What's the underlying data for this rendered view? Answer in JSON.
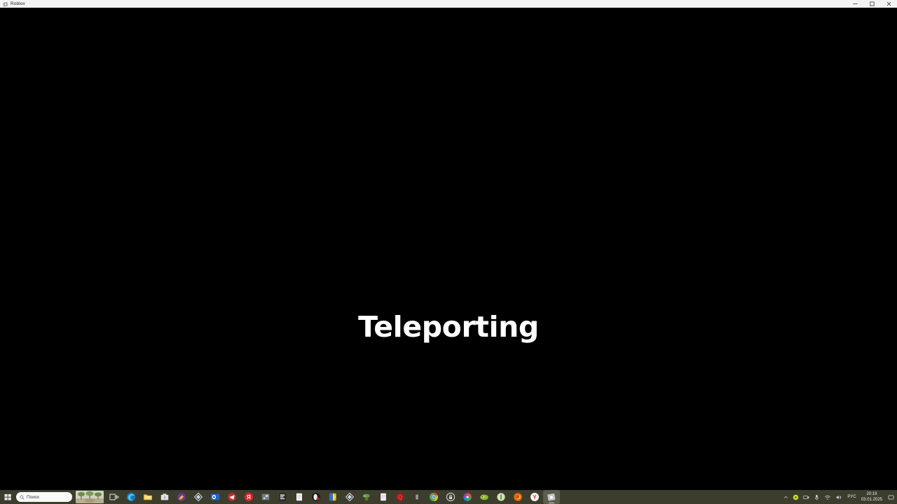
{
  "window": {
    "title": "Roblox",
    "app_icon": "roblox-icon",
    "controls": [
      {
        "name": "minimize-button",
        "glyph": "minimize-icon",
        "label": "Minimize"
      },
      {
        "name": "maximize-button",
        "glyph": "maximize-icon",
        "label": "Maximize"
      },
      {
        "name": "close-button",
        "glyph": "close-icon",
        "label": "Close"
      }
    ]
  },
  "game": {
    "status_text": "Teleporting",
    "background_color": "#000000",
    "text_color": "#ffffff"
  },
  "taskbar": {
    "background_color": "#3d3d2e",
    "start": {
      "label": "Start",
      "icon": "windows-start-icon"
    },
    "search": {
      "placeholder": "Поиск",
      "icon": "search-icon"
    },
    "widget": {
      "name": "weather-widget-thumbnail"
    },
    "apps": [
      {
        "name": "task-view",
        "icon": "task-view-icon",
        "color": "#d8d8d8",
        "active": false
      },
      {
        "name": "microsoft-edge",
        "icon": "edge-icon",
        "color": "#2b88d8",
        "active": false
      },
      {
        "name": "file-explorer",
        "icon": "file-explorer-icon",
        "color": "#ffc846",
        "active": false
      },
      {
        "name": "microsoft-store",
        "icon": "store-icon",
        "color": "#d9d9d9",
        "active": false
      },
      {
        "name": "paint",
        "icon": "paint-icon",
        "color": "#7b3fa0",
        "active": false
      },
      {
        "name": "diamond-app",
        "icon": "diamond-icon",
        "color": "#cfd6e6",
        "active": false
      },
      {
        "name": "outlook",
        "icon": "outlook-icon",
        "color": "#1c6fd0",
        "active": false
      },
      {
        "name": "telegram",
        "icon": "telegram-icon",
        "color": "#c03030",
        "active": false
      },
      {
        "name": "yandex",
        "icon": "yandex-icon",
        "color": "#e02020",
        "active": false
      },
      {
        "name": "steam",
        "icon": "steam-icon",
        "color": "#7c8a99",
        "active": false
      },
      {
        "name": "epic-games",
        "icon": "epic-games-icon",
        "color": "#2a2a2a",
        "active": false
      },
      {
        "name": "notepad",
        "icon": "notepad-icon",
        "color": "#f2f2f2",
        "active": false
      },
      {
        "name": "opera-gx",
        "icon": "opera-gx-icon",
        "color": "#e03030",
        "active": false
      },
      {
        "name": "folder-app",
        "icon": "folder-icon",
        "color": "#f0b400",
        "active": false
      },
      {
        "name": "diamond-app-2",
        "icon": "diamond-icon",
        "color": "#cfd6e6",
        "active": false
      },
      {
        "name": "plant-app",
        "icon": "plant-icon",
        "color": "#4ea53e",
        "active": false
      },
      {
        "name": "document-app",
        "icon": "document-icon",
        "color": "#f2f2f2",
        "active": false
      },
      {
        "name": "q-app",
        "icon": "letter-q-icon",
        "color": "#c81e1e",
        "active": false
      },
      {
        "name": "small-app",
        "icon": "small-square-icon",
        "color": "#9a9a9a",
        "active": false
      },
      {
        "name": "google-chrome",
        "icon": "chrome-icon",
        "color": "#4285f4",
        "active": false
      },
      {
        "name": "lock-app",
        "icon": "lock-circle-icon",
        "color": "#d9d9d9",
        "active": false
      },
      {
        "name": "color-wheel-app",
        "icon": "color-wheel-icon",
        "color": "#8e44ad",
        "active": false
      },
      {
        "name": "green-app",
        "icon": "green-swirl-icon",
        "color": "#7fbf3f",
        "active": false
      },
      {
        "name": "pill-app",
        "icon": "pill-icon",
        "color": "#d5e8c0",
        "active": false
      },
      {
        "name": "firefox",
        "icon": "firefox-icon",
        "color": "#e8690b",
        "active": false
      },
      {
        "name": "yandex-browser",
        "icon": "yandex-browser-icon",
        "color": "#ffffff",
        "active": false
      },
      {
        "name": "roblox",
        "icon": "roblox-icon",
        "color": "#d6d6d6",
        "active": true
      }
    ],
    "tray": {
      "overflow": {
        "name": "show-hidden-icons",
        "icon": "chevron-up-icon"
      },
      "items": [
        {
          "name": "green-status-icon",
          "icon": "green-circle-icon",
          "color": "#c8e020"
        },
        {
          "name": "webcam-icon",
          "icon": "camera-icon",
          "color": "#c9c9c9"
        },
        {
          "name": "microphone-icon",
          "icon": "microphone-icon",
          "color": "#e0e0e0"
        },
        {
          "name": "network-icon",
          "icon": "wifi-icon",
          "color": "#d8d8d8"
        },
        {
          "name": "volume-icon",
          "icon": "speaker-icon",
          "color": "#d8d8d8"
        }
      ],
      "language": "РУС",
      "time": "20:19",
      "date": "03.01.2025",
      "notification": {
        "name": "notification-center",
        "icon": "notification-icon"
      }
    }
  }
}
